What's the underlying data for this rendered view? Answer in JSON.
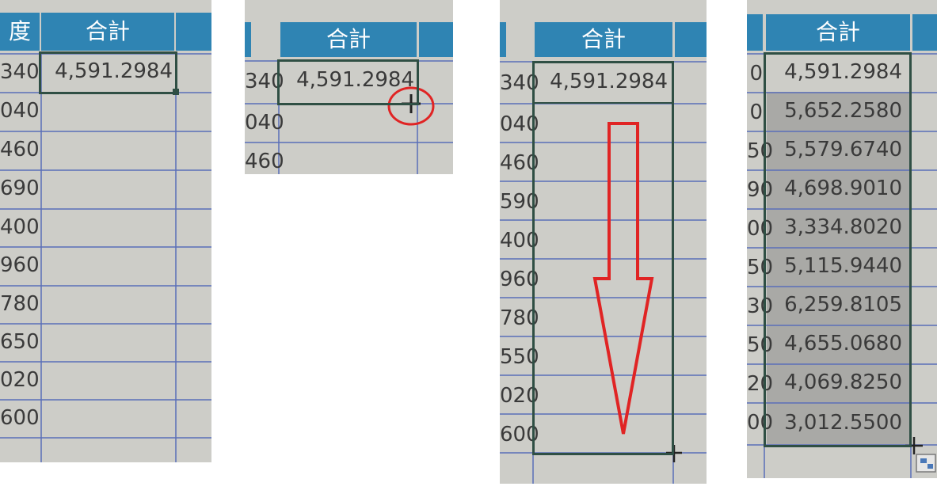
{
  "header_label": "合計",
  "header_left_fragment": "度",
  "first_total": "4,591.2984",
  "left_column_values_p1": [
    "340",
    "040",
    "460",
    "690",
    "400",
    "960",
    "780",
    "650",
    "020",
    " 600"
  ],
  "left_column_values_p2": [
    "340",
    "040",
    "460"
  ],
  "left_column_values_p3": [
    "340",
    "040",
    "460",
    "590",
    "400",
    "960",
    "780",
    "550",
    "020",
    "600"
  ],
  "left_column_values_p4": [
    "0",
    "0",
    "50",
    "90",
    "00",
    "50",
    "30",
    "50",
    "20",
    "00"
  ],
  "filled_totals": [
    "4,591.2984",
    "5,652.2580",
    "5,579.6740",
    "4,698.9010",
    "3,334.8020",
    "5,115.9440",
    "6,259.8105",
    "4,655.0680",
    "4,069.8250",
    "3,012.5500"
  ],
  "colors": {
    "header": "#2f84b3",
    "gridline": "#5a6fb8",
    "selection": "#2f4f44",
    "annotation": "#e02424",
    "cell_bg": "#cdcdc8",
    "filled_bg": "#a9a9a6"
  },
  "icons": {
    "fill_handle": "plus-cursor-icon",
    "drag_arrow": "down-arrow-icon",
    "highlight": "red-circle-icon",
    "autofill_options": "autofill-options-icon"
  }
}
